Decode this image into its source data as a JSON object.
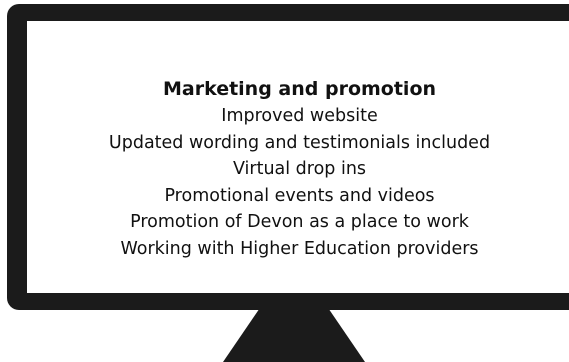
{
  "screen": {
    "heading": "Marketing and promotion",
    "items": [
      "Improved website",
      "Updated wording and testimonials included",
      "Virtual drop ins",
      "Promotional events and videos",
      "Promotion of Devon as a place to work",
      "Working with Higher Education providers"
    ]
  },
  "colors": {
    "monitor": "#1b1b1b",
    "screen": "#ffffff",
    "text": "#111111"
  }
}
